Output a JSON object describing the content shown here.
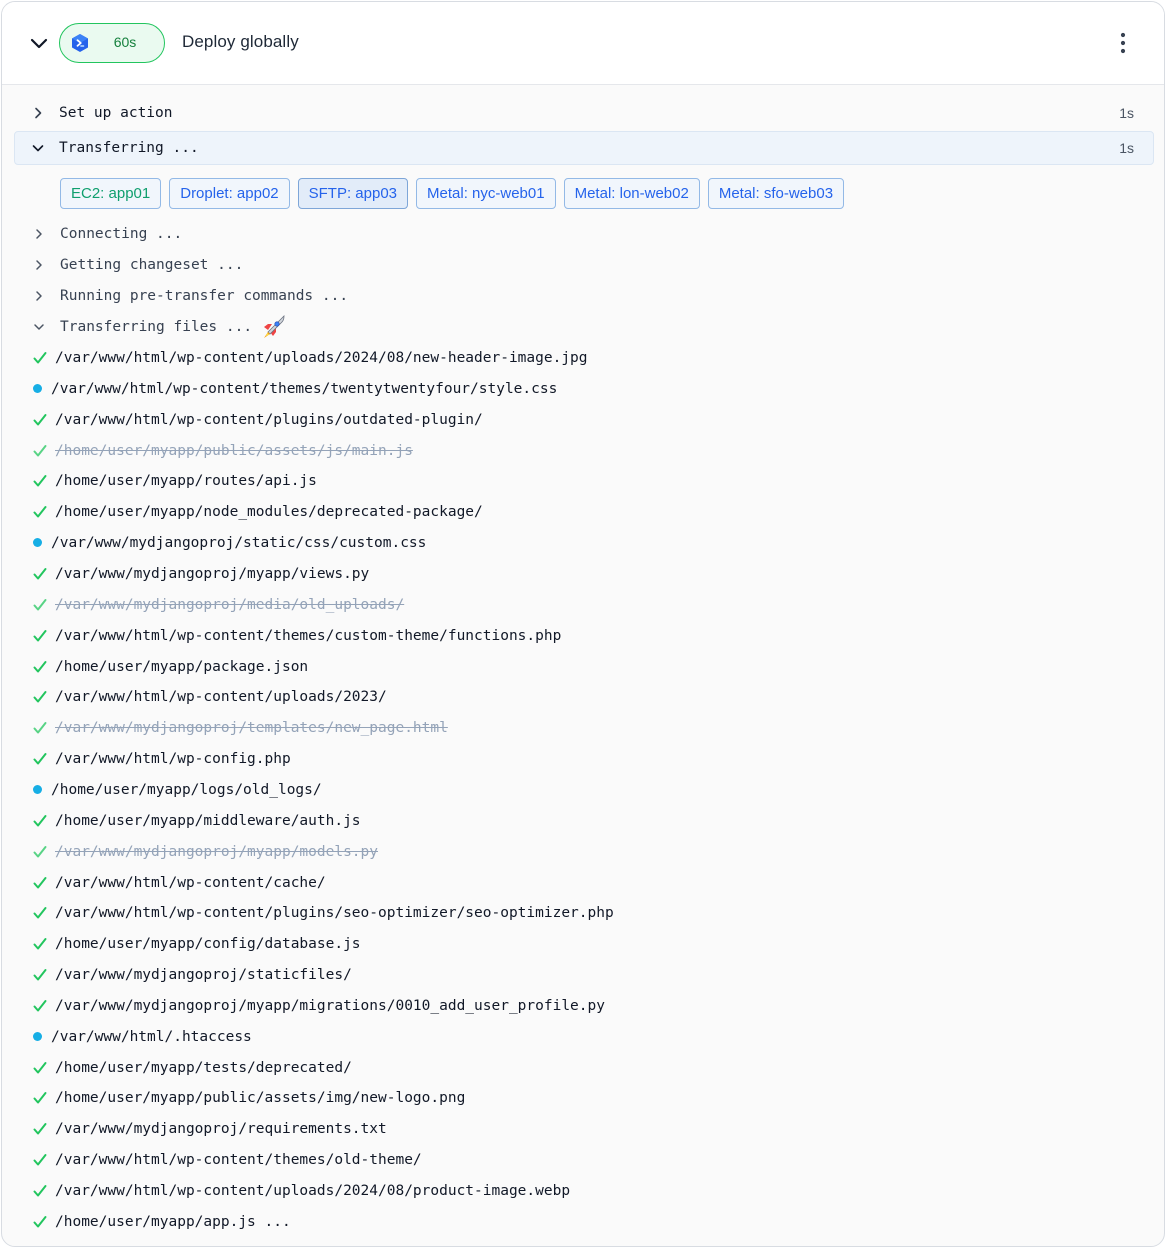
{
  "job": {
    "title": "Deploy globally",
    "duration": "60s"
  },
  "steps": [
    {
      "label": "Set up action",
      "time": "1s",
      "expanded": false
    },
    {
      "label": "Transferring ...",
      "time": "1s",
      "expanded": true
    }
  ],
  "servers": [
    {
      "label": "EC2:  app01",
      "color": "green"
    },
    {
      "label": "Droplet:  app02",
      "color": "blue"
    },
    {
      "label": "SFTP:  app03",
      "color": "blue",
      "selected": true
    },
    {
      "label": "Metal: nyc-web01",
      "color": "blue"
    },
    {
      "label": "Metal: lon-web02",
      "color": "blue"
    },
    {
      "label": "Metal: sfo-web03",
      "color": "blue"
    }
  ],
  "log_sections": [
    {
      "label": "Connecting ...",
      "expanded": false
    },
    {
      "label": "Getting changeset ...",
      "expanded": false
    },
    {
      "label": "Running pre-transfer commands ...",
      "expanded": false
    },
    {
      "label": "Transferring files ...",
      "expanded": true,
      "emoji_icon": "rocket-icon"
    }
  ],
  "files": [
    {
      "path": "/var/www/html/wp-content/uploads/2024/08/new-header-image.jpg",
      "status": "done"
    },
    {
      "path": "/var/www/html/wp-content/themes/twentytwentyfour/style.css",
      "status": "pending"
    },
    {
      "path": "/var/www/html/wp-content/plugins/outdated-plugin/",
      "status": "done"
    },
    {
      "path": "/home/user/myapp/public/assets/js/main.js",
      "status": "deleted"
    },
    {
      "path": "/home/user/myapp/routes/api.js",
      "status": "done"
    },
    {
      "path": "/home/user/myapp/node_modules/deprecated-package/",
      "status": "done"
    },
    {
      "path": "/var/www/mydjangoproj/static/css/custom.css",
      "status": "pending"
    },
    {
      "path": "/var/www/mydjangoproj/myapp/views.py",
      "status": "done"
    },
    {
      "path": "/var/www/mydjangoproj/media/old_uploads/",
      "status": "deleted"
    },
    {
      "path": "/var/www/html/wp-content/themes/custom-theme/functions.php",
      "status": "done"
    },
    {
      "path": "/home/user/myapp/package.json",
      "status": "done"
    },
    {
      "path": "/var/www/html/wp-content/uploads/2023/",
      "status": "done"
    },
    {
      "path": "/var/www/mydjangoproj/templates/new_page.html",
      "status": "deleted"
    },
    {
      "path": "/var/www/html/wp-config.php",
      "status": "done"
    },
    {
      "path": "/home/user/myapp/logs/old_logs/",
      "status": "pending"
    },
    {
      "path": "/home/user/myapp/middleware/auth.js",
      "status": "done"
    },
    {
      "path": "/var/www/mydjangoproj/myapp/models.py",
      "status": "deleted"
    },
    {
      "path": "/var/www/html/wp-content/cache/",
      "status": "done"
    },
    {
      "path": "/var/www/html/wp-content/plugins/seo-optimizer/seo-optimizer.php",
      "status": "done"
    },
    {
      "path": "/home/user/myapp/config/database.js",
      "status": "done"
    },
    {
      "path": "/var/www/mydjangoproj/staticfiles/",
      "status": "done"
    },
    {
      "path": "/var/www/mydjangoproj/myapp/migrations/0010_add_user_profile.py",
      "status": "done"
    },
    {
      "path": "/var/www/html/.htaccess",
      "status": "pending"
    },
    {
      "path": "/home/user/myapp/tests/deprecated/",
      "status": "done"
    },
    {
      "path": "/home/user/myapp/public/assets/img/new-logo.png",
      "status": "done"
    },
    {
      "path": "/var/www/mydjangoproj/requirements.txt",
      "status": "done"
    },
    {
      "path": "/var/www/html/wp-content/themes/old-theme/",
      "status": "done"
    },
    {
      "path": "/var/www/html/wp-content/uploads/2024/08/product-image.webp",
      "status": "done"
    },
    {
      "path": "/home/user/myapp/app.js ...",
      "status": "done"
    }
  ],
  "colors": {
    "success": "#22c55e",
    "pending": "#16aee5",
    "deleted": "#94a3b8",
    "link": "#2563eb",
    "server_green": "#0f9f6e"
  },
  "icons": {
    "collapse": "chevron-down-icon",
    "expand": "chevron-right-icon",
    "menu": "kebab-menu-icon",
    "action": "hexagon-terminal-icon"
  }
}
